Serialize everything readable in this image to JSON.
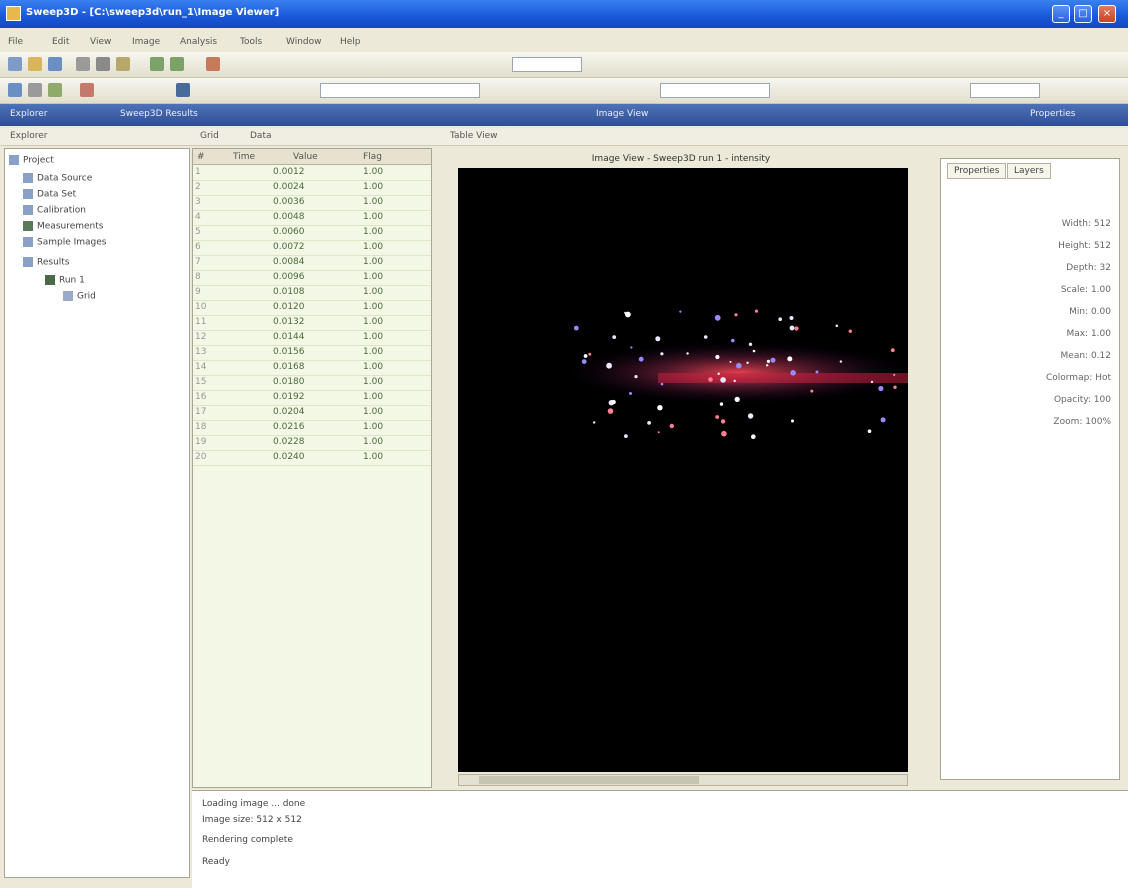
{
  "window": {
    "title": "Sweep3D - [C:\\sweep3d\\run_1\\Image Viewer]",
    "minimize": "_",
    "maximize": "□",
    "close": "×"
  },
  "menu": [
    "File",
    "Edit",
    "View",
    "Image",
    "Analysis",
    "Tools",
    "Window",
    "Help"
  ],
  "bluebar": {
    "left": "Explorer",
    "middle": "Sweep3D Results",
    "center": "Image View",
    "right": "Properties"
  },
  "subbar": [
    "Explorer",
    "Grid",
    "Data",
    "Table View"
  ],
  "tree": [
    "Project",
    "Data Source",
    "Data Set",
    "Calibration",
    "Measurements",
    "Sample Images",
    "Results",
    "Run 1",
    "Grid"
  ],
  "grid": {
    "headers": [
      "#",
      "Time",
      "Value",
      "Flag"
    ],
    "rows": [
      {
        "n": "1",
        "a": "0.0012",
        "b": "1.00"
      },
      {
        "n": "2",
        "a": "0.0024",
        "b": "1.00"
      },
      {
        "n": "3",
        "a": "0.0036",
        "b": "1.00"
      },
      {
        "n": "4",
        "a": "0.0048",
        "b": "1.00"
      },
      {
        "n": "5",
        "a": "0.0060",
        "b": "1.00"
      },
      {
        "n": "6",
        "a": "0.0072",
        "b": "1.00"
      },
      {
        "n": "7",
        "a": "0.0084",
        "b": "1.00"
      },
      {
        "n": "8",
        "a": "0.0096",
        "b": "1.00"
      },
      {
        "n": "9",
        "a": "0.0108",
        "b": "1.00"
      },
      {
        "n": "10",
        "a": "0.0120",
        "b": "1.00"
      },
      {
        "n": "11",
        "a": "0.0132",
        "b": "1.00"
      },
      {
        "n": "12",
        "a": "0.0144",
        "b": "1.00"
      },
      {
        "n": "13",
        "a": "0.0156",
        "b": "1.00"
      },
      {
        "n": "14",
        "a": "0.0168",
        "b": "1.00"
      },
      {
        "n": "15",
        "a": "0.0180",
        "b": "1.00"
      },
      {
        "n": "16",
        "a": "0.0192",
        "b": "1.00"
      },
      {
        "n": "17",
        "a": "0.0204",
        "b": "1.00"
      },
      {
        "n": "18",
        "a": "0.0216",
        "b": "1.00"
      },
      {
        "n": "19",
        "a": "0.0228",
        "b": "1.00"
      },
      {
        "n": "20",
        "a": "0.0240",
        "b": "1.00"
      }
    ]
  },
  "image_title": "Image View - Sweep3D run 1 - intensity",
  "right_panel": {
    "tabs": [
      "Properties",
      "Layers"
    ],
    "props": [
      "Width: 512",
      "Height: 512",
      "Depth: 32",
      "Scale: 1.00",
      "Min: 0.00",
      "Max: 1.00",
      "Mean: 0.12",
      "Colormap: Hot",
      "Opacity: 100",
      "Zoom: 100%"
    ]
  },
  "output": [
    "Loading image ... done",
    "Image size: 512 x 512",
    "Rendering complete",
    "Ready"
  ],
  "colors": {
    "title_bar": "#1957d8",
    "bluebar": "#3a5ba0",
    "viewer_bg": "#000000",
    "grid_bg": "#f3f7e6"
  }
}
